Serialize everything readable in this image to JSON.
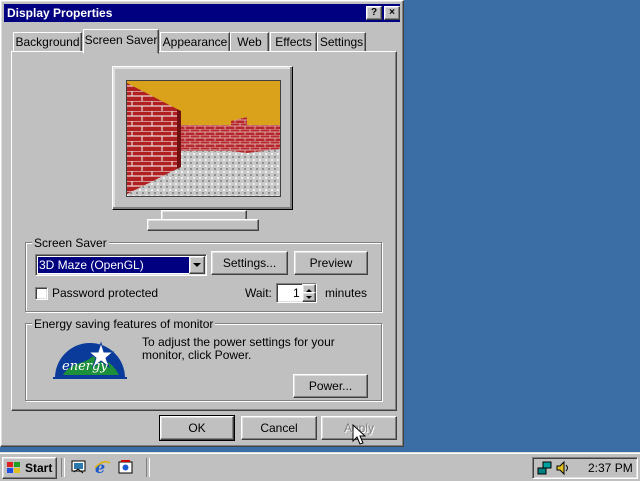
{
  "window": {
    "title": "Display Properties",
    "help_label": "?",
    "close_label": "×"
  },
  "tabs": [
    {
      "label": "Background"
    },
    {
      "label": "Screen Saver",
      "active": true
    },
    {
      "label": "Appearance"
    },
    {
      "label": "Web"
    },
    {
      "label": "Effects"
    },
    {
      "label": "Settings"
    }
  ],
  "screen_saver": {
    "group_label": "Screen Saver",
    "selected": "3D Maze (OpenGL)",
    "settings_label": "Settings...",
    "preview_label": "Preview",
    "password_label": "Password protected",
    "password_checked": false,
    "wait_label": "Wait:",
    "wait_value": "1",
    "wait_units": "minutes"
  },
  "energy": {
    "group_label": "Energy saving features of monitor",
    "description": "To adjust the power settings for your monitor, click Power.",
    "power_label": "Power...",
    "logo_text": "energy"
  },
  "footer": {
    "ok_label": "OK",
    "cancel_label": "Cancel",
    "apply_label": "Apply"
  },
  "taskbar": {
    "start_label": "Start",
    "quicklaunch": [
      "desktop-icon",
      "internet-explorer-icon",
      "channels-icon"
    ],
    "tray_icons": [
      "network-icon",
      "volume-icon"
    ],
    "clock": "2:37 PM"
  },
  "colors": {
    "desktop": "#3a6ea5",
    "titlebar": "#000080",
    "face": "#c0c0c0",
    "selection": "#000080"
  }
}
